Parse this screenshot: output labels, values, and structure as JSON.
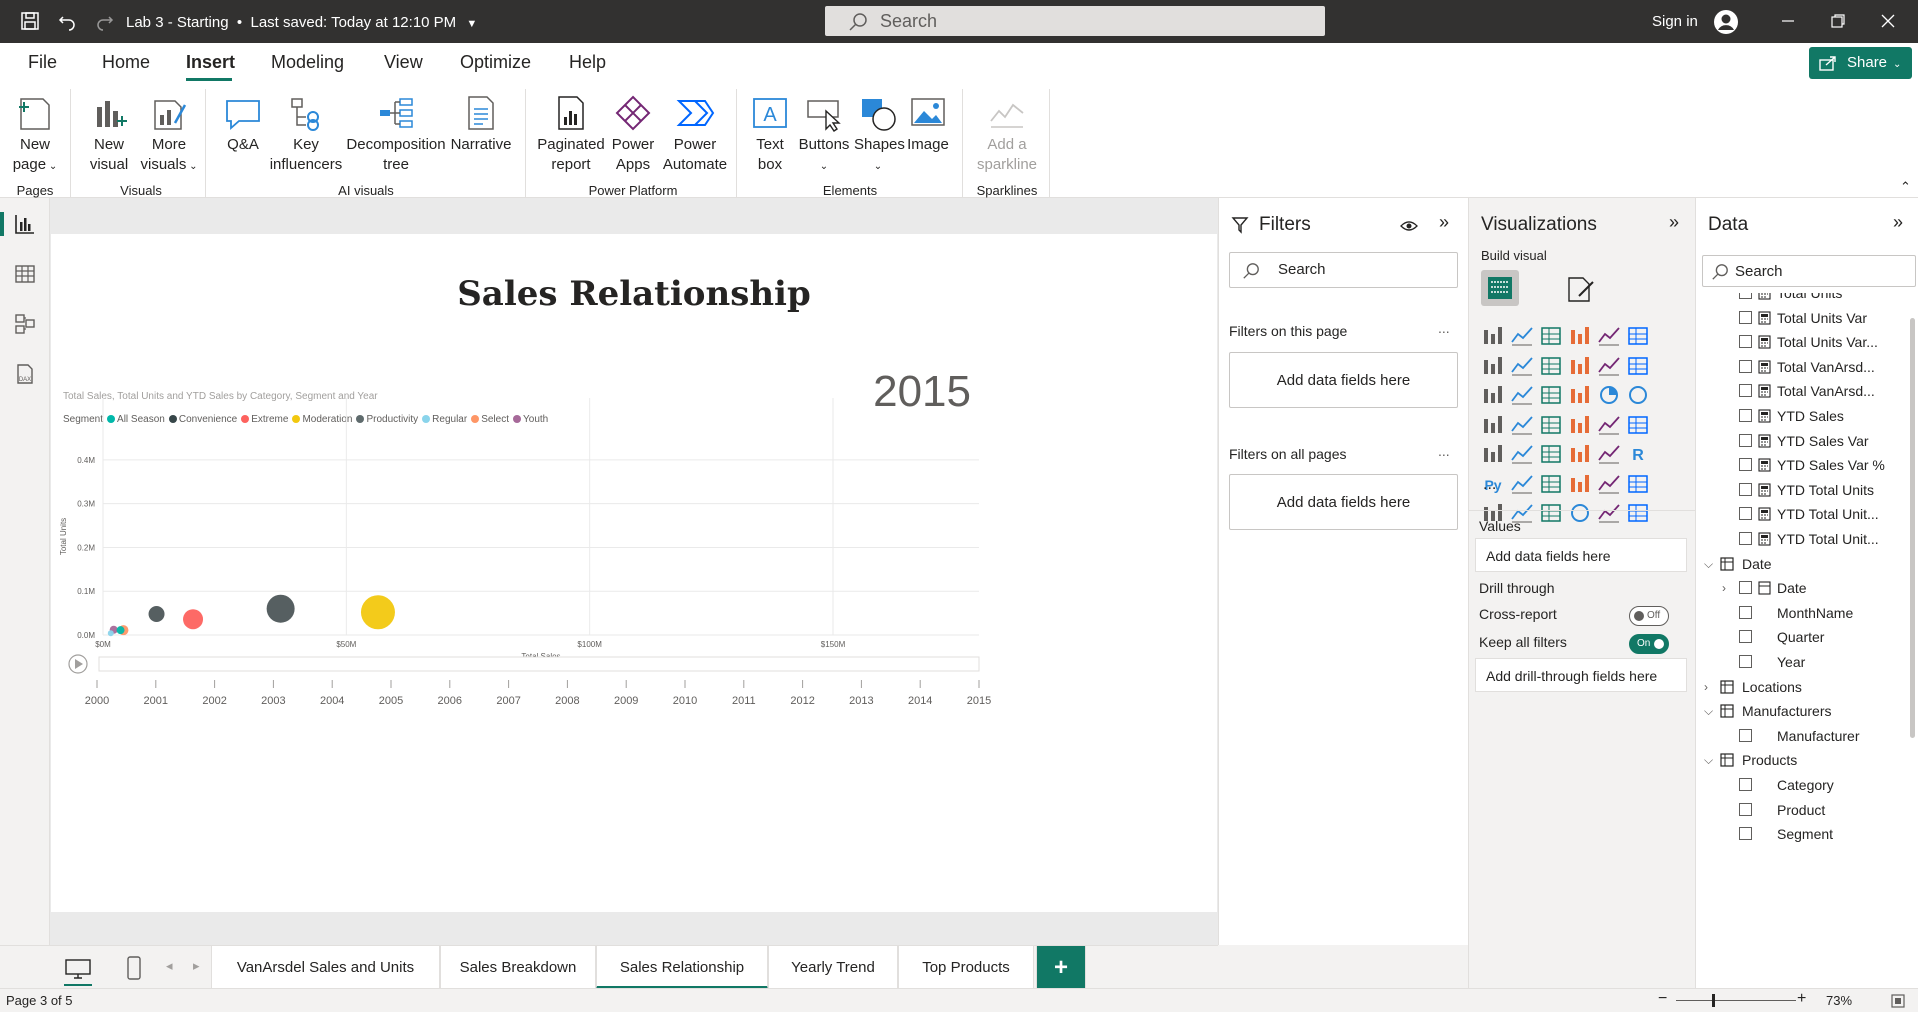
{
  "titlebar": {
    "file_title": "Lab 3 - Starting",
    "save_status": "Last saved: Today at 12:10 PM",
    "search_placeholder": "Search",
    "sign_in": "Sign in"
  },
  "menu": {
    "items": [
      "File",
      "Home",
      "Insert",
      "Modeling",
      "View",
      "Optimize",
      "Help"
    ],
    "active": "Insert",
    "share": "Share"
  },
  "ribbon": {
    "new_page": [
      "New",
      "page"
    ],
    "new_visual": [
      "New",
      "visual"
    ],
    "more_visuals": [
      "More",
      "visuals"
    ],
    "qa": "Q&A",
    "key_influencers": [
      "Key",
      "influencers"
    ],
    "decomposition_tree": [
      "Decomposition",
      "tree"
    ],
    "narrative": "Narrative",
    "paginated_report": [
      "Paginated",
      "report"
    ],
    "power_apps": [
      "Power",
      "Apps"
    ],
    "power_automate": [
      "Power",
      "Automate"
    ],
    "text_box": [
      "Text",
      "box"
    ],
    "buttons": "Buttons",
    "shapes": "Shapes",
    "image": "Image",
    "add_sparkline": [
      "Add a",
      "sparkline"
    ],
    "groups": {
      "pages": "Pages",
      "visuals": "Visuals",
      "ai_visuals": "AI visuals",
      "power_platform": "Power Platform",
      "elements": "Elements",
      "sparklines": "Sparklines"
    }
  },
  "report": {
    "title": "Sales Relationship",
    "chart_subtitle": "Total Sales, Total Units and YTD Sales by Category, Segment and Year",
    "legend_title": "Segment",
    "year_label": "2015"
  },
  "chart_data": {
    "type": "scatter",
    "title": "Total Sales, Total Units and YTD Sales by Category, Segment and Year",
    "xlabel": "Total Sales",
    "ylabel": "Total Units",
    "xlim": [
      0,
      180
    ],
    "ylim": [
      0,
      0.45
    ],
    "x_ticks": [
      "$0M",
      "$50M",
      "$100M",
      "$150M"
    ],
    "x_tick_values": [
      0,
      50,
      100,
      150
    ],
    "y_ticks": [
      "0.0M",
      "0.1M",
      "0.2M",
      "0.3M",
      "0.4M"
    ],
    "y_tick_values": [
      0,
      0.1,
      0.2,
      0.3,
      0.4
    ],
    "legend": [
      {
        "name": "All Season",
        "color": "#01b8aa"
      },
      {
        "name": "Convenience",
        "color": "#374649"
      },
      {
        "name": "Extreme",
        "color": "#fd625e"
      },
      {
        "name": "Moderation",
        "color": "#f2c80f"
      },
      {
        "name": "Productivity",
        "color": "#5f6b6d"
      },
      {
        "name": "Regular",
        "color": "#8ad4eb"
      },
      {
        "name": "Select",
        "color": "#fe9666"
      },
      {
        "name": "Youth",
        "color": "#a66999"
      }
    ],
    "points": [
      {
        "segment": "Convenience",
        "x": 11,
        "y": 0.048,
        "size": 8,
        "color": "#4d5658"
      },
      {
        "segment": "Extreme",
        "x": 18.5,
        "y": 0.036,
        "size": 10,
        "color": "#fd625e"
      },
      {
        "segment": "Productivity",
        "x": 36.5,
        "y": 0.06,
        "size": 14,
        "color": "#4d5658"
      },
      {
        "segment": "Moderation",
        "x": 56.5,
        "y": 0.052,
        "size": 17,
        "color": "#f2c80f"
      },
      {
        "segment": "Youth",
        "x": 2.2,
        "y": 0.012,
        "size": 4,
        "color": "#a66999"
      },
      {
        "segment": "Select",
        "x": 4.2,
        "y": 0.011,
        "size": 5,
        "color": "#fe9666"
      },
      {
        "segment": "Regular",
        "x": 1.6,
        "y": 0.004,
        "size": 3,
        "color": "#8ad4eb"
      },
      {
        "segment": "All Season",
        "x": 3.6,
        "y": 0.011,
        "size": 4,
        "color": "#01b8aa"
      }
    ],
    "play_axis": {
      "years": [
        "2000",
        "2001",
        "2002",
        "2003",
        "2004",
        "2005",
        "2006",
        "2007",
        "2008",
        "2009",
        "2010",
        "2011",
        "2012",
        "2013",
        "2014",
        "2015"
      ],
      "current": "2015"
    }
  },
  "filters": {
    "title": "Filters",
    "search_placeholder": "Search",
    "on_this_page": "Filters on this page",
    "on_all_pages": "Filters on all pages",
    "add_fields": "Add data fields here",
    "more": "..."
  },
  "visualizations": {
    "title": "Visualizations",
    "build_visual": "Build visual",
    "values": "Values",
    "add_fields": "Add data fields here",
    "drill_through": "Drill through",
    "cross_report": "Cross-report",
    "cross_report_state": "Off",
    "keep_all_filters": "Keep all filters",
    "keep_all_state": "On",
    "add_drill": "Add drill-through fields here",
    "more": "..."
  },
  "data": {
    "title": "Data",
    "search_placeholder": "Search",
    "items": [
      {
        "label": "Total Units",
        "level": 2,
        "kind": "measure"
      },
      {
        "label": "Total Units Var",
        "level": 2,
        "kind": "measure"
      },
      {
        "label": "Total Units Var...",
        "level": 2,
        "kind": "measure"
      },
      {
        "label": "Total VanArsd...",
        "level": 2,
        "kind": "measure"
      },
      {
        "label": "Total VanArsd...",
        "level": 2,
        "kind": "measure"
      },
      {
        "label": "YTD Sales",
        "level": 2,
        "kind": "measure"
      },
      {
        "label": "YTD Sales Var",
        "level": 2,
        "kind": "measure"
      },
      {
        "label": "YTD Sales Var %",
        "level": 2,
        "kind": "measure"
      },
      {
        "label": "YTD Total Units",
        "level": 2,
        "kind": "measure"
      },
      {
        "label": "YTD Total Unit...",
        "level": 2,
        "kind": "measure"
      },
      {
        "label": "YTD Total Unit...",
        "level": 2,
        "kind": "measure"
      },
      {
        "label": "Date",
        "level": 1,
        "kind": "table-open"
      },
      {
        "label": "Date",
        "level": 2,
        "kind": "hierarchy"
      },
      {
        "label": "MonthName",
        "level": 2,
        "kind": "field"
      },
      {
        "label": "Quarter",
        "level": 2,
        "kind": "field"
      },
      {
        "label": "Year",
        "level": 2,
        "kind": "field"
      },
      {
        "label": "Locations",
        "level": 1,
        "kind": "table-closed"
      },
      {
        "label": "Manufacturers",
        "level": 1,
        "kind": "table-open"
      },
      {
        "label": "Manufacturer",
        "level": 2,
        "kind": "field"
      },
      {
        "label": "Products",
        "level": 1,
        "kind": "table-open"
      },
      {
        "label": "Category",
        "level": 2,
        "kind": "field"
      },
      {
        "label": "Product",
        "level": 2,
        "kind": "field"
      },
      {
        "label": "Segment",
        "level": 2,
        "kind": "field"
      }
    ]
  },
  "tabs": {
    "items": [
      "VanArsdel Sales and Units",
      "Sales Breakdown",
      "Sales Relationship",
      "Yearly Trend",
      "Top Products"
    ],
    "active": "Sales Relationship",
    "add": "+"
  },
  "status": {
    "page": "Page 3 of 5",
    "zoom": "73%"
  },
  "colors": {
    "accent": "#117865",
    "titlebar": "#323130"
  }
}
